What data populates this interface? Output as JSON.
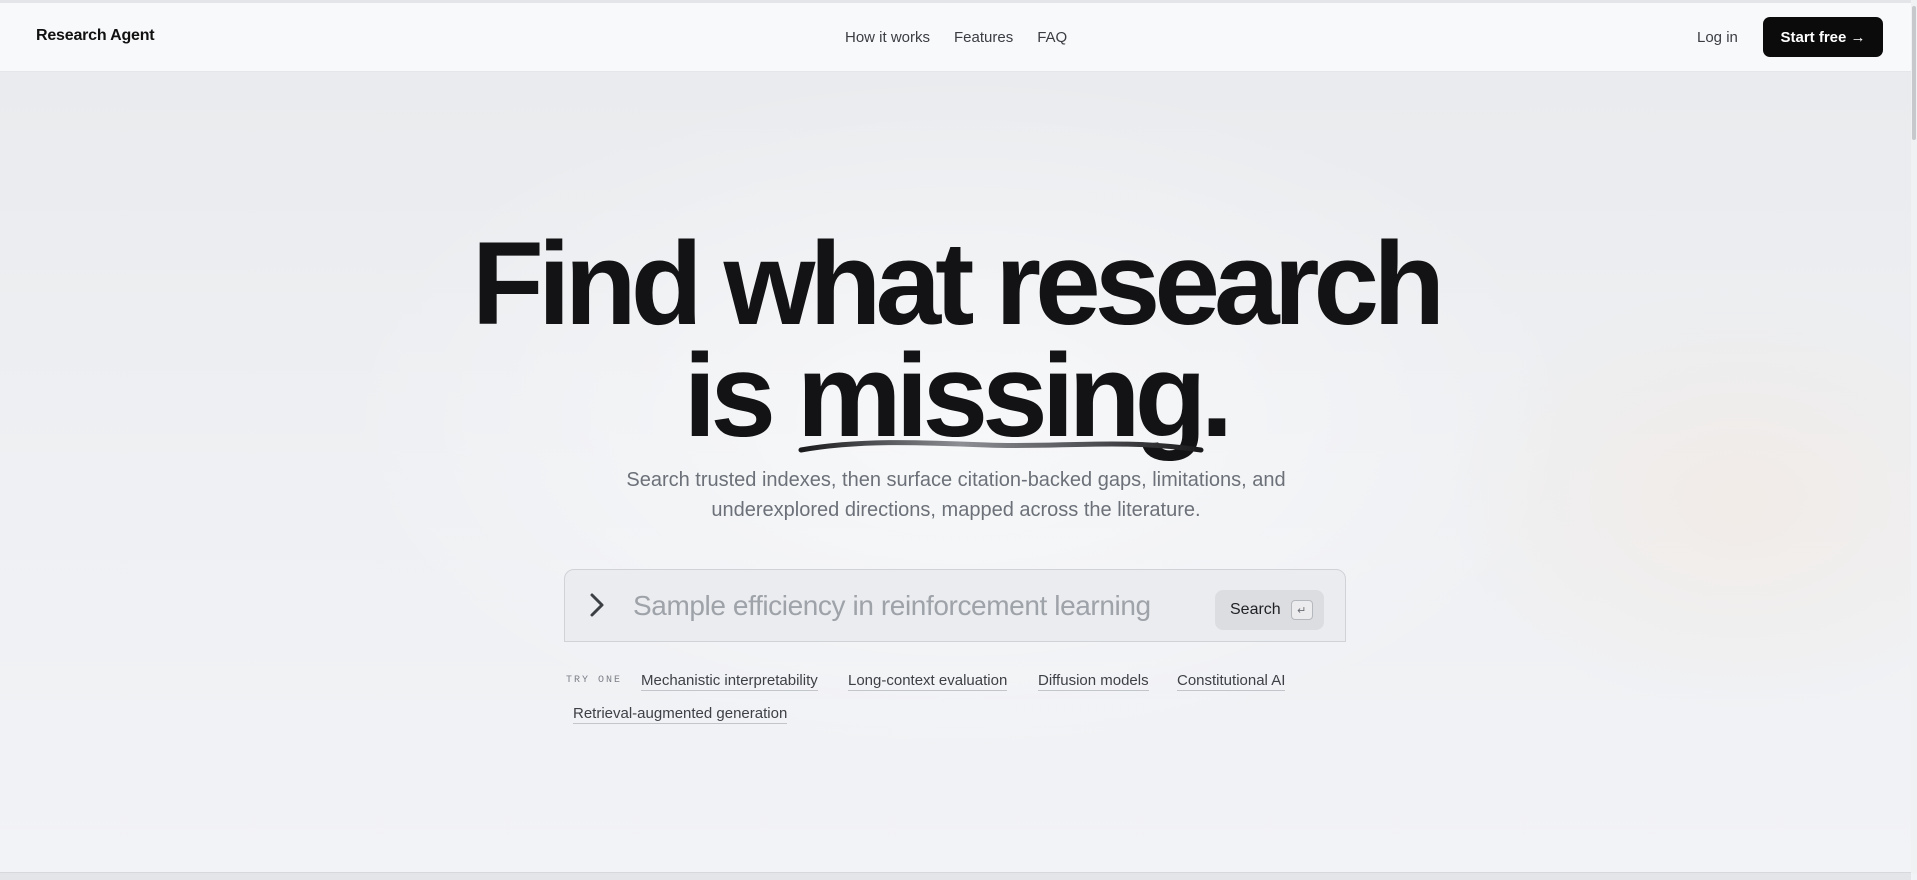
{
  "header": {
    "brand": "Research Agent",
    "nav": [
      "How it works",
      "Features",
      "FAQ"
    ],
    "login": "Log in",
    "cta": "Start free →"
  },
  "hero": {
    "headline_line1": "Find what research",
    "headline_line2_prefix": "is ",
    "headline_emphasis": "missing.",
    "subtitle_line1": "Search trusted indexes, then surface citation-backed gaps, limitations, and",
    "subtitle_line2": "underexplored directions, mapped across the literature."
  },
  "search": {
    "placeholder": "Sample efficiency in reinforcement learning",
    "value": "",
    "button_label": "Search",
    "shortcut_glyph": "↵"
  },
  "suggestions": {
    "label": "TRY ONE",
    "items": [
      "Mechanistic interpretability",
      "Long-context evaluation",
      "Diffusion models",
      "Constitutional AI",
      "Retrieval-augmented generation"
    ]
  },
  "icons": {
    "prompt": "chevron-right-icon",
    "shortcut": "enter-key-icon"
  }
}
